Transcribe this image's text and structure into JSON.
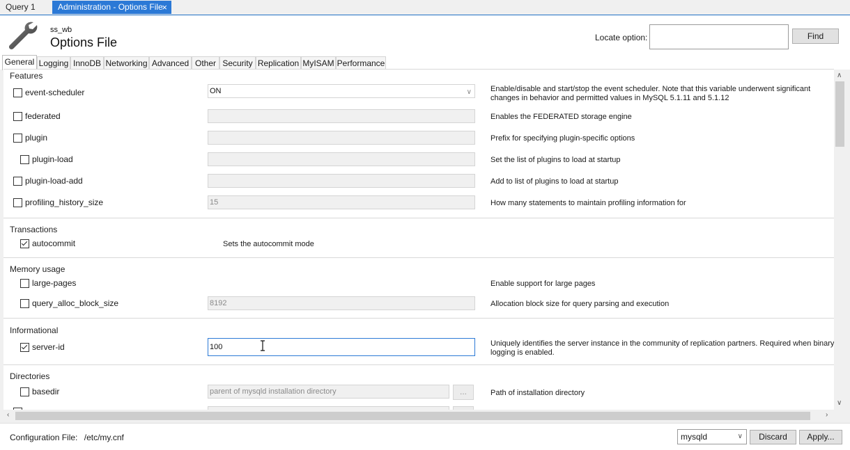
{
  "doc_tabs": {
    "inactive": "Query 1",
    "active": "Administration - Options File",
    "close": "×"
  },
  "header": {
    "connection": "ss_wb",
    "title": "Options File",
    "locate_label": "Locate option:",
    "locate_value": "",
    "find_label": "Find"
  },
  "category_tabs": [
    "General",
    "Logging",
    "InnoDB",
    "Networking",
    "Advanced",
    "Other",
    "Security",
    "Replication",
    "MyISAM",
    "Performance"
  ],
  "sections": {
    "features": {
      "title": "Features",
      "event_scheduler": {
        "label": "event-scheduler",
        "value": "ON",
        "checked": false,
        "desc": "Enable/disable and start/stop the event scheduler. Note that this variable underwent significant changes in behavior and permitted values in MySQL 5.1.11 and 5.1.12"
      },
      "federated": {
        "label": "federated",
        "value": "",
        "checked": false,
        "desc": "Enables the FEDERATED storage engine"
      },
      "plugin": {
        "label": "plugin",
        "value": "",
        "checked": false,
        "desc": "Prefix for specifying plugin-specific options"
      },
      "plugin_load": {
        "label": "plugin-load",
        "value": "",
        "checked": false,
        "desc": "Set the list of plugins to load at startup"
      },
      "plugin_load_add": {
        "label": "plugin-load-add",
        "value": "",
        "checked": false,
        "desc": "Add to list of plugins to load at startup"
      },
      "profiling_history_size": {
        "label": "profiling_history_size",
        "value": "15",
        "checked": false,
        "desc": "How many statements to maintain profiling information for"
      }
    },
    "transactions": {
      "title": "Transactions",
      "autocommit": {
        "label": "autocommit",
        "checked": true,
        "desc": "Sets the autocommit mode"
      }
    },
    "memory_usage": {
      "title": "Memory usage",
      "large_pages": {
        "label": "large-pages",
        "checked": false,
        "desc": "Enable support for large pages"
      },
      "query_alloc_block_size": {
        "label": "query_alloc_block_size",
        "value": "8192",
        "checked": false,
        "desc": "Allocation block size for query parsing and execution"
      }
    },
    "informational": {
      "title": "Informational",
      "server_id": {
        "label": "server-id",
        "value": "100",
        "checked": true,
        "desc": "Uniquely identifies the server instance in the community of replication partners. Required when binary logging is enabled."
      }
    },
    "directories": {
      "title": "Directories",
      "basedir": {
        "label": "basedir",
        "value": "parent of mysqld installation directory",
        "checked": false,
        "browse": "...",
        "desc": "Path of installation directory"
      }
    }
  },
  "footer": {
    "config_label": "Configuration File:",
    "config_path": "/etc/my.cnf",
    "section": "mysqld",
    "discard_label": "Discard",
    "apply_label": "Apply..."
  },
  "colors": {
    "accent": "#2b79d6",
    "tab_border": "#1f6ec4"
  },
  "icons": {
    "wrench": "wrench-icon",
    "close": "close-icon",
    "dropdown": "chevron-down-icon"
  }
}
